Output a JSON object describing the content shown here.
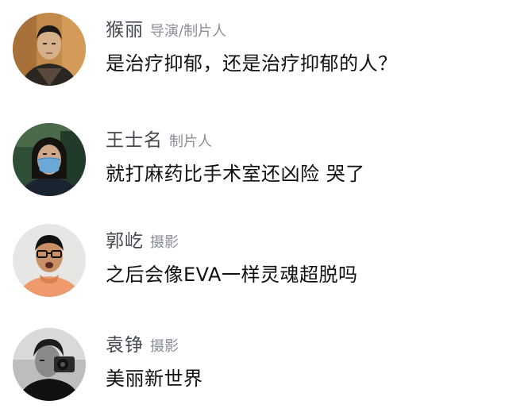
{
  "comments": [
    {
      "author": "猴丽",
      "role": "导演/制片人",
      "text": "是治疗抑郁，还是治疗抑郁的人？"
    },
    {
      "author": "王士名",
      "role": "制片人",
      "text": "就打麻药比手术室还凶险 哭了"
    },
    {
      "author": "郭屹",
      "role": "摄影",
      "text": "之后会像EVA一样灵魂超脱吗"
    },
    {
      "author": "袁铮",
      "role": "摄影",
      "text": "美丽新世界"
    }
  ]
}
